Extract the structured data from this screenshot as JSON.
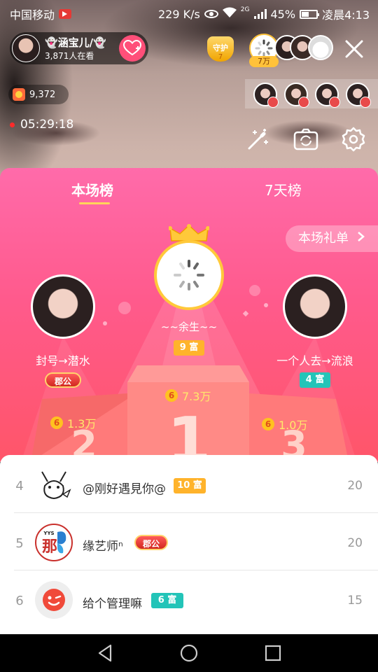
{
  "status_bar": {
    "carrier": "中国移动",
    "speed": "229 K/s",
    "network": "2G",
    "battery": "45%",
    "time": "凌晨4:13"
  },
  "host": {
    "name": "👻涵宝儿/👻",
    "viewers": "3,871人在看"
  },
  "guard": {
    "label": "守护",
    "count": "7"
  },
  "contribution": {
    "value": "7万"
  },
  "coins": "9,372",
  "live_timer": "05:29:18",
  "tabs": [
    {
      "label": "本场榜",
      "active": true
    },
    {
      "label": "7天榜",
      "active": false
    }
  ],
  "gift_list_label": "本场礼单",
  "podium": {
    "first": {
      "place": "1",
      "name": "~~余生~~",
      "rich_level": "9 富",
      "score": "7.3万"
    },
    "second": {
      "place": "2",
      "name": "封号→潜水",
      "noble_title": "郡公",
      "score": "1.3万"
    },
    "third": {
      "place": "3",
      "name": "一个人去→流浪",
      "rich_level": "4 富",
      "score": "1.0万"
    }
  },
  "ranking_list": [
    {
      "rank": "4",
      "name": "@刚好遇見你@",
      "badge": "10 富",
      "badge_type": "rich-gold",
      "score": "20"
    },
    {
      "rank": "5",
      "name": "缘艺师ⁿ",
      "badge": "郡公",
      "badge_type": "noble",
      "score": "20"
    },
    {
      "rank": "6",
      "name": "给个管理嘛",
      "badge": "6 富",
      "badge_type": "rich-teal",
      "score": "15"
    }
  ],
  "avatar_text": {
    "rank5_brand": "YYS",
    "rank5_glyph": "那"
  },
  "colors": {
    "panel_top": "#ff6baa",
    "panel_bottom": "#ff5569",
    "accent_gold": "#ffb32b",
    "accent_teal": "#23c4b8",
    "follow_pink": "#ff4f79"
  }
}
